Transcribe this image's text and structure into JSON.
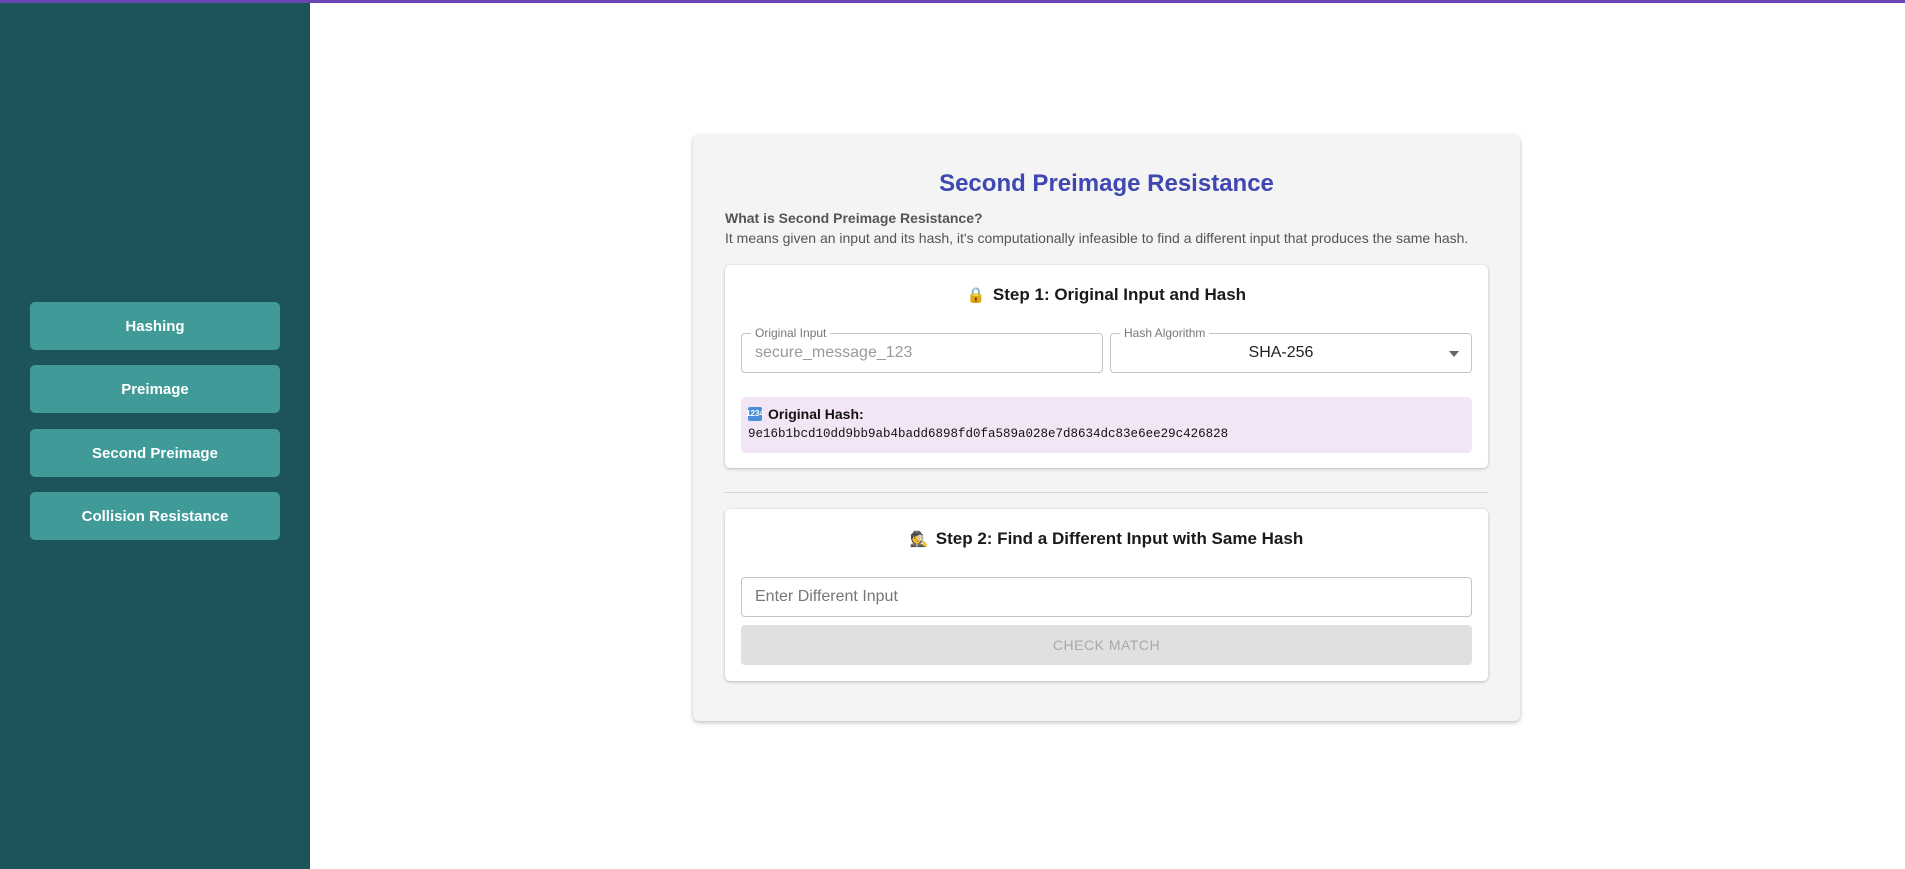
{
  "sidebar": {
    "items": [
      {
        "label": "Hashing"
      },
      {
        "label": "Preimage"
      },
      {
        "label": "Second Preimage"
      },
      {
        "label": "Collision Resistance"
      }
    ]
  },
  "main": {
    "title": "Second Preimage Resistance",
    "what_title": "What is Second Preimage Resistance?",
    "what_body": "It means given an input and its hash, it's computationally infeasible to find a different input that produces the same hash.",
    "step1": {
      "icon": "lock-icon",
      "heading": "Step 1: Original Input and Hash",
      "original_input": {
        "label": "Original Input",
        "value": "secure_message_123"
      },
      "hash_algorithm": {
        "label": "Hash Algorithm",
        "selected": "SHA-256"
      },
      "hash": {
        "icon": "numbers-icon",
        "label": "Original Hash:",
        "value": "9e16b1bcd10dd9bb9ab4badd6898fd0fa589a028e7d8634dc83e6ee29c426828"
      }
    },
    "step2": {
      "icon": "detective-icon",
      "heading": "Step 2: Find a Different Input with Same Hash",
      "input_placeholder": "Enter Different Input",
      "check_label": "CHECK MATCH"
    }
  },
  "colors": {
    "sidebar_bg": "#1d5459",
    "nav_button_bg": "#3f9a98",
    "title": "#3f47b0",
    "top_accent": "#6a46b7",
    "hash_box_bg": "#f2e5f5"
  }
}
